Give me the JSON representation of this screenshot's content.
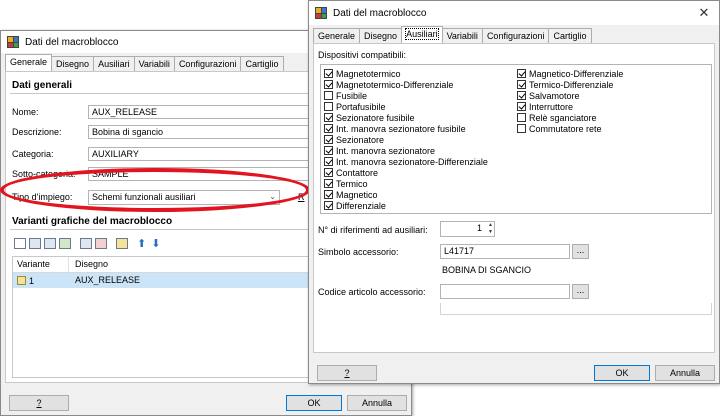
{
  "colors": {
    "annotation": "#e2141f",
    "selection": "#cce4f7",
    "default_button": "#0078d7"
  },
  "back_window": {
    "title": "Dati del macroblocco",
    "tabs": [
      "Generale",
      "Disegno",
      "Ausiliari",
      "Variabili",
      "Configurazioni",
      "Cartiglio"
    ],
    "section_general": "Dati generali",
    "fields": {
      "nome": {
        "label": "Nome:",
        "value": "AUX_RELEASE"
      },
      "descrizione": {
        "label": "Descrizione:",
        "value": "Bobina di sgancio"
      },
      "categoria": {
        "label": "Categoria:",
        "value": "AUXILIARY"
      },
      "sotto_categoria": {
        "label": "Sotto-categoria:",
        "value": "SAMPLE"
      },
      "tipo_impiego": {
        "label": "Tipo d'impiego:",
        "value": "Schemi funzionali ausiliari",
        "extra": "R"
      }
    },
    "section_variants": "Varianti grafiche del macroblocco",
    "toolbar_icons": [
      "new-icon",
      "copy-icon",
      "paste-icon",
      "import-icon",
      "duplicate-icon",
      "delete-icon",
      "edit-icon",
      "arrow-up-icon",
      "arrow-down-icon"
    ],
    "table": {
      "columns": [
        "Variante",
        "Disegno"
      ],
      "rows": [
        {
          "variante": "1",
          "disegno": "AUX_RELEASE"
        }
      ]
    },
    "buttons": {
      "help": "?",
      "ok": "OK",
      "cancel": "Annulla"
    }
  },
  "front_window": {
    "title": "Dati del macroblocco",
    "close": "✕",
    "tabs": [
      "Generale",
      "Disegno",
      "Ausiliari",
      "Variabili",
      "Configurazioni",
      "Cartiglio"
    ],
    "compat_label": "Dispositivi compatibili:",
    "devices_left": [
      {
        "label": "Magnetotermico",
        "checked": true
      },
      {
        "label": "Magnetotermico-Differenziale",
        "checked": true
      },
      {
        "label": "Fusibile",
        "checked": false
      },
      {
        "label": "Portafusibile",
        "checked": false
      },
      {
        "label": "Sezionatore fusibile",
        "checked": true
      },
      {
        "label": "Int. manovra sezionatore fusibile",
        "checked": true
      },
      {
        "label": "Sezionatore",
        "checked": true
      },
      {
        "label": "Int. manovra sezionatore",
        "checked": true
      },
      {
        "label": "Int. manovra sezionatore-Differenziale",
        "checked": true
      },
      {
        "label": "Contattore",
        "checked": true
      },
      {
        "label": "Termico",
        "checked": true
      },
      {
        "label": "Magnetico",
        "checked": true
      },
      {
        "label": "Differenziale",
        "checked": true
      }
    ],
    "devices_right": [
      {
        "label": "Magnetico-Differenziale",
        "checked": true
      },
      {
        "label": "Termico-Differenziale",
        "checked": true
      },
      {
        "label": "Salvamotore",
        "checked": true
      },
      {
        "label": "Interruttore",
        "checked": true
      },
      {
        "label": "Relè sganciatore",
        "checked": false
      },
      {
        "label": "Commutatore rete",
        "checked": false
      }
    ],
    "refs_label": "N° di riferimenti ad ausiliari:",
    "refs_value": "1",
    "simbolo_label": "Simbolo accessorio:",
    "simbolo_value": "L41717",
    "simbolo_desc": "BOBINA DI SGANCIO",
    "codice_label": "Codice articolo accessorio:",
    "codice_value": "",
    "browse": "...",
    "buttons": {
      "help": "?",
      "ok": "OK",
      "cancel": "Annulla"
    }
  }
}
